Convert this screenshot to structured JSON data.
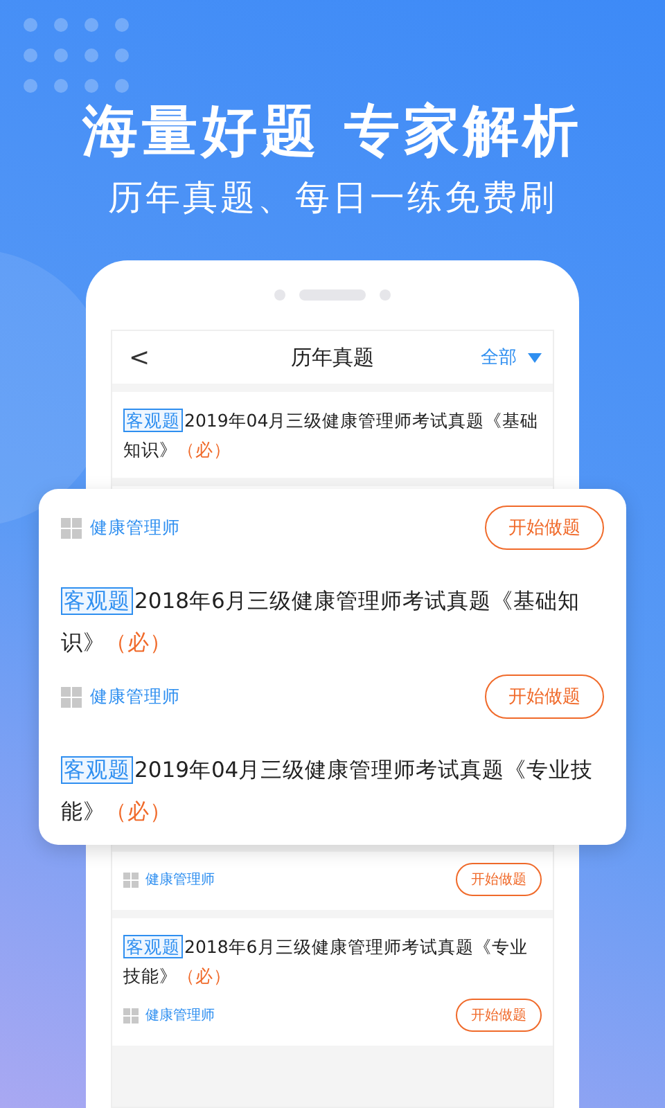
{
  "headline": "海量好题 专家解析",
  "subheadline": "历年真题、每日一练免费刷",
  "screen": {
    "back": "<",
    "title": "历年真题",
    "filter": "全部",
    "list": [
      {
        "kind": "title_only",
        "tag": "客观题",
        "title": "2019年04月三级健康管理师考试真题《基础知识》",
        "mark": "（必）"
      },
      {
        "kind": "hidden"
      },
      {
        "kind": "footer_only",
        "category": "健康管理师",
        "button": "开始做题"
      },
      {
        "kind": "full",
        "tag": "客观题",
        "title": "2018年6月三级健康管理师考试真题《专业技能》",
        "mark": "（必）",
        "category": "健康管理师",
        "button": "开始做题"
      }
    ]
  },
  "popup_card": {
    "items": [
      {
        "kind": "footer_only",
        "category": "健康管理师",
        "button": "开始做题"
      },
      {
        "kind": "full",
        "tag": "客观题",
        "title": "2018年6月三级健康管理师考试真题《基础知识》",
        "mark": "（必）",
        "category": "健康管理师",
        "button": "开始做题"
      },
      {
        "kind": "title_only",
        "tag": "客观题",
        "title": "2019年04月三级健康管理师考试真题《专业技能》",
        "mark": "（必）"
      }
    ]
  }
}
